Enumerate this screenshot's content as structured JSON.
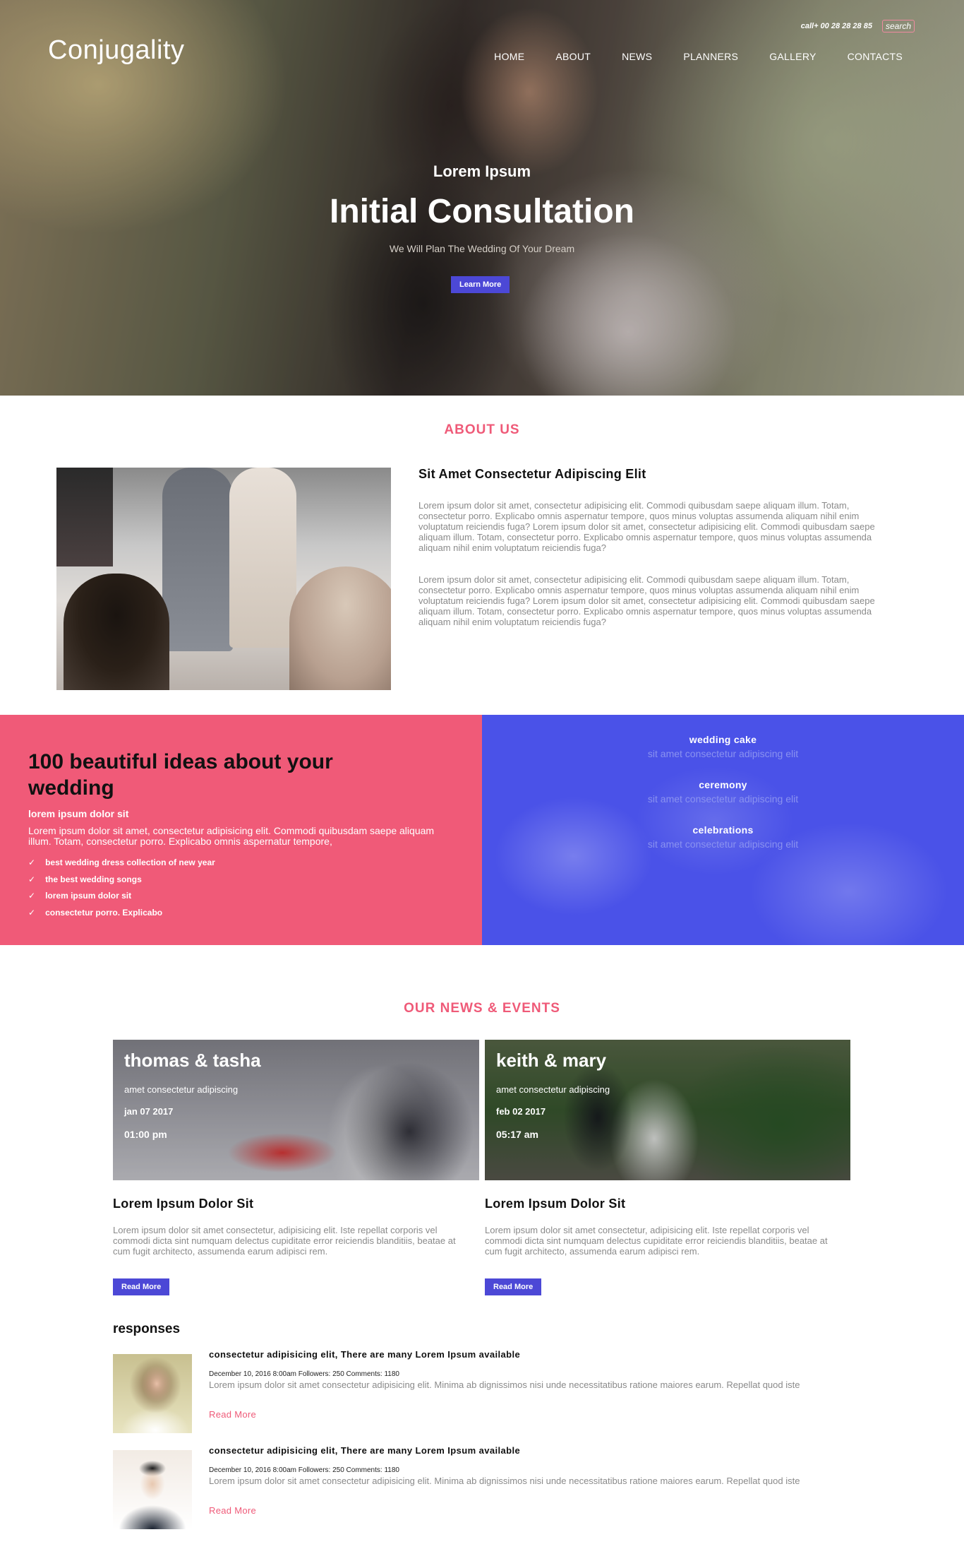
{
  "header": {
    "logo": "Conjugality",
    "phone": "call+ 00 28 28 28 85",
    "search_label": "search",
    "nav": [
      "HOME",
      "ABOUT",
      "NEWS",
      "PLANNERS",
      "GALLERY",
      "CONTACTS"
    ]
  },
  "hero": {
    "subtitle": "Lorem Ipsum",
    "title": "Initial Consultation",
    "tagline": "We Will Plan The Wedding Of Your Dream",
    "button": "Learn More"
  },
  "about": {
    "section_title": "ABOUT US",
    "heading": "Sit Amet Consectetur Adipiscing Elit",
    "paragraphs": [
      "Lorem ipsum dolor sit amet, consectetur adipisicing elit. Commodi quibusdam saepe aliquam illum. Totam, consectetur porro. Explicabo omnis aspernatur tempore, quos minus voluptas assumenda aliquam nihil enim voluptatum reiciendis fuga? Lorem ipsum dolor sit amet, consectetur adipisicing elit. Commodi quibusdam saepe aliquam illum. Totam, consectetur porro. Explicabo omnis aspernatur tempore, quos minus voluptas assumenda aliquam nihil enim voluptatum reiciendis fuga?",
      "Lorem ipsum dolor sit amet, consectetur adipisicing elit. Commodi quibusdam saepe aliquam illum. Totam, consectetur porro. Explicabo omnis aspernatur tempore, quos minus voluptas assumenda aliquam nihil enim voluptatum reiciendis fuga? Lorem ipsum dolor sit amet, consectetur adipisicing elit. Commodi quibusdam saepe aliquam illum. Totam, consectetur porro. Explicabo omnis aspernatur tempore, quos minus voluptas assumenda aliquam nihil enim voluptatum reiciendis fuga?"
    ]
  },
  "ideas": {
    "title": "100 beautiful ideas about your wedding",
    "subtitle": "lorem ipsum dolor sit",
    "text": "Lorem ipsum dolor sit amet, consectetur adipisicing elit. Commodi quibusdam saepe aliquam illum. Totam, consectetur porro. Explicabo omnis aspernatur tempore,",
    "check_icon": "✓",
    "list": [
      "best wedding dress collection of new year",
      "the best wedding songs",
      "lorem ipsum dolor sit",
      "consectetur porro. Explicabo"
    ]
  },
  "services": [
    {
      "name": "wedding cake",
      "desc": "sit amet consectetur adipiscing elit"
    },
    {
      "name": "ceremony",
      "desc": "sit amet consectetur adipiscing elit"
    },
    {
      "name": "celebrations",
      "desc": "sit amet consectetur adipiscing elit"
    }
  ],
  "news": {
    "section_title": "OUR NEWS & EVENTS",
    "items": [
      {
        "names": "thomas & tasha",
        "subtitle": "amet consectetur adipiscing",
        "date": "jan 07 2017",
        "time": "01:00 pm",
        "heading": "Lorem Ipsum Dolor Sit",
        "text": "Lorem ipsum dolor sit amet consectetur, adipisicing elit. Iste repellat corporis vel commodi dicta sint numquam delectus cupiditate error reiciendis blanditiis, beatae at cum fugit architecto, assumenda earum adipisci rem.",
        "button": "Read More"
      },
      {
        "names": "keith & mary",
        "subtitle": "amet consectetur adipiscing",
        "date": "feb 02 2017",
        "time": "05:17 am",
        "heading": "Lorem Ipsum Dolor Sit",
        "text": "Lorem ipsum dolor sit amet consectetur, adipisicing elit. Iste repellat corporis vel commodi dicta sint numquam delectus cupiditate error reiciendis blanditiis, beatae at cum fugit architecto, assumenda earum adipisci rem.",
        "button": "Read More"
      }
    ]
  },
  "responses": {
    "title": "responses",
    "items": [
      {
        "heading": "consectetur adipisicing elit, There are many Lorem Ipsum available",
        "meta": "December 10, 2016 8:00am Followers: 250 Comments: 1180",
        "text": "Lorem ipsum dolor sit amet consectetur adipisicing elit. Minima ab dignissimos nisi unde necessitatibus ratione maiores earum. Repellat quod iste",
        "link": "Read More"
      },
      {
        "heading": "consectetur adipisicing elit, There are many Lorem Ipsum available",
        "meta": "December 10, 2016 8:00am Followers: 250 Comments: 1180",
        "text": "Lorem ipsum dolor sit amet consectetur adipisicing elit. Minima ab dignissimos nisi unde necessitatibus ratione maiores earum. Repellat quod iste",
        "link": "Read More"
      }
    ]
  },
  "colors": {
    "accent": "#f05a78",
    "button": "#4c48d6",
    "services_bg": "#4a52e8"
  }
}
